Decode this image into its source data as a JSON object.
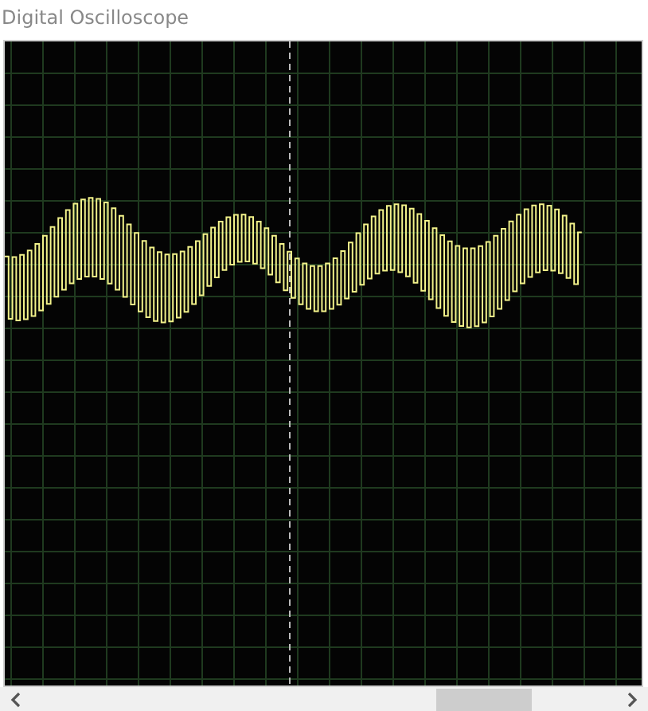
{
  "window": {
    "title": "Digital Oscilloscope"
  }
}
